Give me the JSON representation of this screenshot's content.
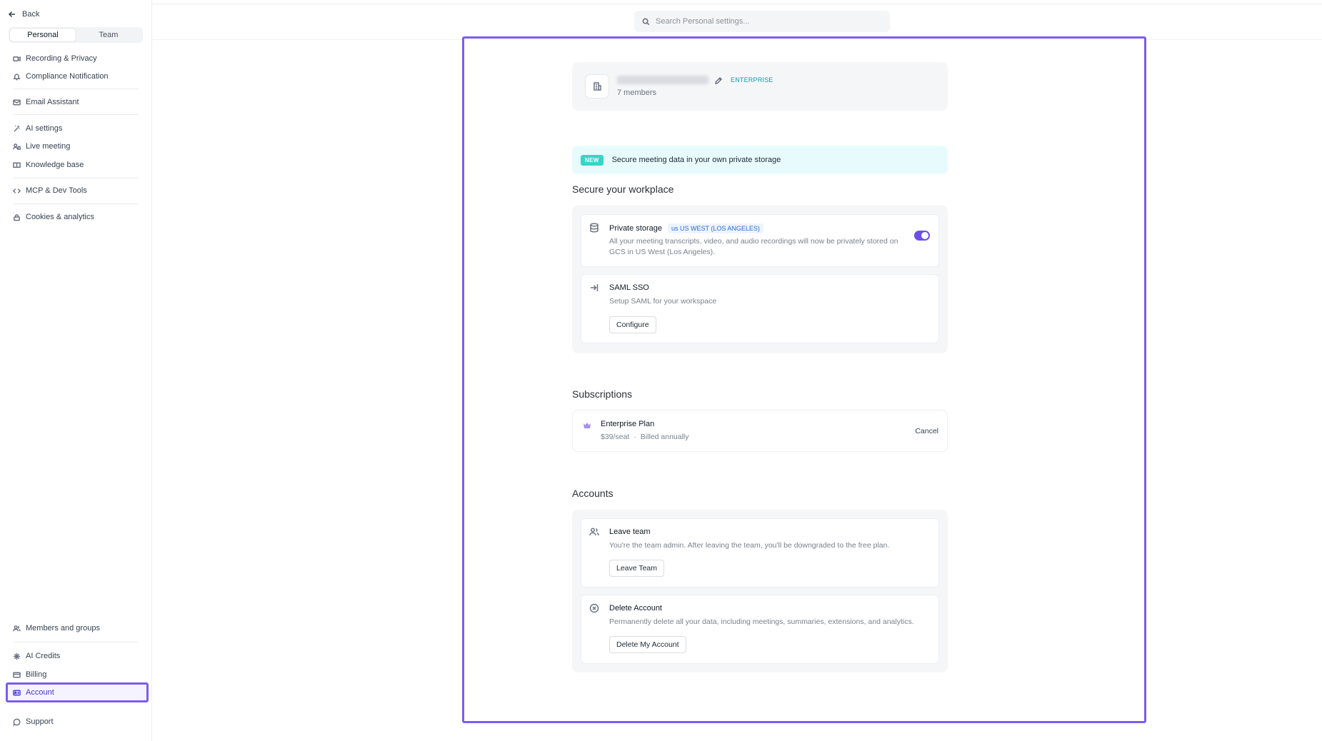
{
  "sidebar": {
    "back_label": "Back",
    "tabs": [
      {
        "label": "Personal",
        "active": true
      },
      {
        "label": "Team",
        "active": false
      }
    ],
    "items": [
      {
        "label": "Recording & Privacy",
        "icon": "video-icon"
      },
      {
        "label": "Compliance Notification",
        "icon": "bell-icon"
      },
      {
        "label": "Email Assistant",
        "icon": "mail-icon"
      },
      {
        "label": "AI settings",
        "icon": "magic-wand-icon"
      },
      {
        "label": "Live meeting",
        "icon": "live-meeting-icon"
      },
      {
        "label": "Knowledge base",
        "icon": "book-icon"
      },
      {
        "label": "MCP & Dev Tools",
        "icon": "code-icon"
      },
      {
        "label": "Cookies & analytics",
        "icon": "lock-icon"
      },
      {
        "label": "Members and groups",
        "icon": "users-icon"
      },
      {
        "label": "AI Credits",
        "icon": "sparkle-icon"
      },
      {
        "label": "Billing",
        "icon": "card-icon"
      },
      {
        "label": "Account",
        "icon": "id-card-icon",
        "active": true
      },
      {
        "label": "Support",
        "icon": "chat-icon"
      }
    ]
  },
  "search": {
    "placeholder": "Search Personal settings..."
  },
  "team": {
    "plan_tag": "ENTERPRISE",
    "members": "7 members"
  },
  "banner": {
    "badge": "NEW",
    "text": "Secure meeting data in your own private storage"
  },
  "security": {
    "title": "Secure your workplace",
    "private_storage": {
      "title": "Private storage",
      "region": "us US WEST (LOS ANGELES)",
      "description": "All your meeting transcripts, video, and audio recordings will now be privately stored on GCS in US West (Los Angeles).",
      "enabled": true
    },
    "saml": {
      "title": "SAML SSO",
      "description": "Setup SAML for your workspace",
      "button": "Configure"
    }
  },
  "subscriptions": {
    "title": "Subscriptions",
    "plan_name": "Enterprise Plan",
    "price": "$39/seat",
    "separator": "·",
    "billing": "Billed annually",
    "cancel": "Cancel"
  },
  "accounts": {
    "title": "Accounts",
    "leave": {
      "title": "Leave team",
      "description": "You're the team admin. After leaving the team, you'll be downgraded to the free plan.",
      "button": "Leave Team"
    },
    "delete": {
      "title": "Delete Account",
      "description": "Permanently delete all your data, including meetings, summaries, extensions, and analytics.",
      "button": "Delete My Account"
    }
  },
  "colors": {
    "accent": "#7b5cf0",
    "toggle_on": "#6d4fe8",
    "plan_tag": "#0e9ab3",
    "new_badge": "#34d6c8",
    "banner_bg": "#e8fbfc"
  }
}
